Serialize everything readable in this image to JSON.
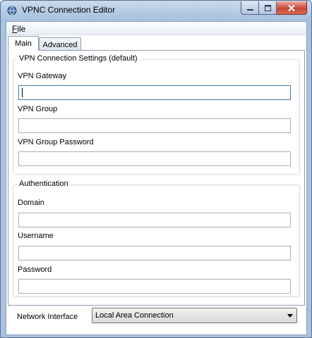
{
  "window": {
    "title": "VPNC Connection Editor",
    "icons": {
      "app": "vpnc-app-icon",
      "minimize": "minimize-icon",
      "maximize": "maximize-icon",
      "close": "close-icon"
    }
  },
  "menu": {
    "file_accel": "F",
    "file_rest": "ile"
  },
  "tabs": {
    "main": "Main",
    "advanced": "Advanced",
    "active": "Main"
  },
  "settings": {
    "legend": "VPN Connection Settings (default)",
    "gateway_label": "VPN Gateway",
    "gateway_value": "",
    "group_label": "VPN Group",
    "group_value": "",
    "group_password_label": "VPN Group Password",
    "group_password_value": ""
  },
  "auth": {
    "legend": "Authentication",
    "domain_label": "Domain",
    "domain_value": "",
    "username_label": "Username",
    "username_value": "",
    "password_label": "Password",
    "password_value": ""
  },
  "network": {
    "label": "Network Interface",
    "selected": "Local Area Connection",
    "arrow_icon": "dropdown-arrow-icon"
  },
  "colors": {
    "titlebar": "#a7c0dc",
    "close_button": "#c7473a",
    "focus_border": "#3d7bad"
  }
}
